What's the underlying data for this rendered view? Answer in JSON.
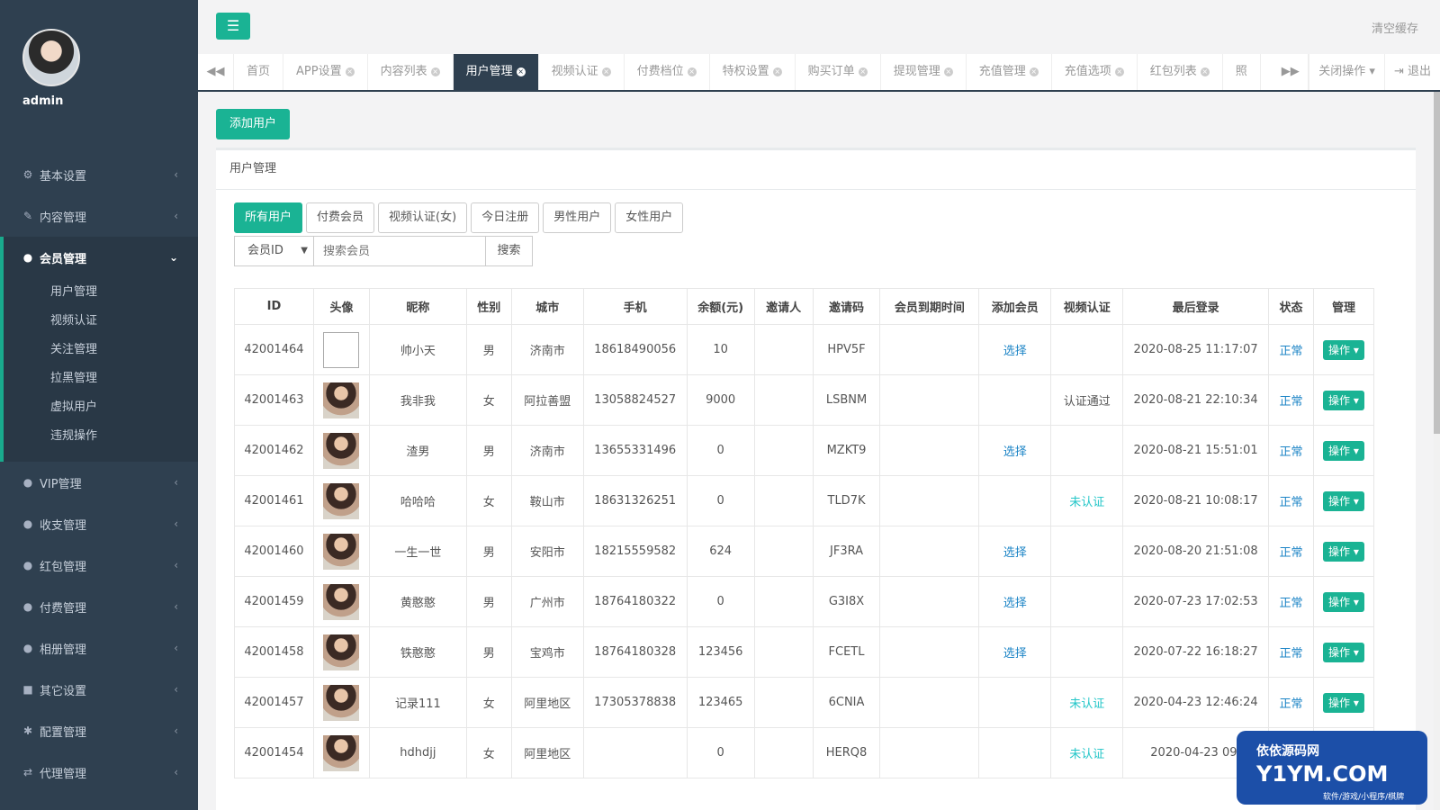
{
  "sidebar": {
    "admin_name": "admin",
    "nav": [
      {
        "label": "基本设置",
        "icon": "gear-icon"
      },
      {
        "label": "内容管理",
        "icon": "edit-icon"
      }
    ],
    "active_section": {
      "label": "会员管理",
      "sub_items": [
        "用户管理",
        "视频认证",
        "关注管理",
        "拉黑管理",
        "虚拟用户",
        "违规操作"
      ]
    },
    "nav_after": [
      {
        "label": "VIP管理",
        "icon": "user-icon"
      },
      {
        "label": "收支管理",
        "icon": "user-icon"
      },
      {
        "label": "红包管理",
        "icon": "user-icon"
      },
      {
        "label": "付费管理",
        "icon": "user-icon"
      },
      {
        "label": "相册管理",
        "icon": "user-icon"
      },
      {
        "label": "其它设置",
        "icon": "book-icon"
      },
      {
        "label": "配置管理",
        "icon": "asterisk-icon"
      },
      {
        "label": "代理管理",
        "icon": "exchange-icon"
      }
    ]
  },
  "topbar": {
    "clear_cache": "清空缓存"
  },
  "tabs": [
    "首页",
    "APP设置",
    "内容列表",
    "用户管理",
    "视频认证",
    "付费档位",
    "特权设置",
    "购买订单",
    "提现管理",
    "充值管理",
    "充值选项",
    "红包列表",
    "照"
  ],
  "tab_actions": {
    "close_ops": "关闭操作",
    "logout": "退出"
  },
  "main": {
    "add_user": "添加用户",
    "panel_title": "用户管理",
    "filters": [
      "所有用户",
      "付费会员",
      "视频认证(女)",
      "今日注册",
      "男性用户",
      "女性用户"
    ],
    "search": {
      "select_value": "会员ID",
      "placeholder": "搜索会员",
      "button": "搜索"
    }
  },
  "table": {
    "headers": [
      "ID",
      "头像",
      "昵称",
      "性别",
      "城市",
      "手机",
      "余额(元)",
      "邀请人",
      "邀请码",
      "会员到期时间",
      "添加会员",
      "视频认证",
      "最后登录",
      "状态",
      "管理"
    ],
    "rows": [
      {
        "id": "42001464",
        "avatar": "empty",
        "nick": "帅小天",
        "gender": "男",
        "city": "济南市",
        "phone": "18618490056",
        "balance": "10",
        "inviter": "",
        "code": "HPV5F",
        "expire": "",
        "add_member": "选择",
        "video": "",
        "last_login": "2020-08-25 11:17:07",
        "status": "正常",
        "op": "操作"
      },
      {
        "id": "42001463",
        "avatar": "photo",
        "nick": "我非我",
        "gender": "女",
        "city": "阿拉善盟",
        "phone": "13058824527",
        "balance": "9000",
        "inviter": "",
        "code": "LSBNM",
        "expire": "",
        "add_member": "",
        "video": "认证通过",
        "last_login": "2020-08-21 22:10:34",
        "status": "正常",
        "op": "操作"
      },
      {
        "id": "42001462",
        "avatar": "photo",
        "nick": "渣男",
        "gender": "男",
        "city": "济南市",
        "phone": "13655331496",
        "balance": "0",
        "inviter": "",
        "code": "MZKT9",
        "expire": "",
        "add_member": "选择",
        "video": "",
        "last_login": "2020-08-21 15:51:01",
        "status": "正常",
        "op": "操作"
      },
      {
        "id": "42001461",
        "avatar": "photo",
        "nick": "哈哈哈",
        "gender": "女",
        "city": "鞍山市",
        "phone": "18631326251",
        "balance": "0",
        "inviter": "",
        "code": "TLD7K",
        "expire": "",
        "add_member": "",
        "video": "未认证",
        "last_login": "2020-08-21 10:08:17",
        "status": "正常",
        "op": "操作"
      },
      {
        "id": "42001460",
        "avatar": "photo",
        "nick": "一生一世",
        "gender": "男",
        "city": "安阳市",
        "phone": "18215559582",
        "balance": "624",
        "inviter": "",
        "code": "JF3RA",
        "expire": "",
        "add_member": "选择",
        "video": "",
        "last_login": "2020-08-20 21:51:08",
        "status": "正常",
        "op": "操作"
      },
      {
        "id": "42001459",
        "avatar": "photo",
        "nick": "黄憨憨",
        "gender": "男",
        "city": "广州市",
        "phone": "18764180322",
        "balance": "0",
        "inviter": "",
        "code": "G3I8X",
        "expire": "",
        "add_member": "选择",
        "video": "",
        "last_login": "2020-07-23 17:02:53",
        "status": "正常",
        "op": "操作"
      },
      {
        "id": "42001458",
        "avatar": "photo",
        "nick": "铁憨憨",
        "gender": "男",
        "city": "宝鸡市",
        "phone": "18764180328",
        "balance": "123456",
        "inviter": "",
        "code": "FCETL",
        "expire": "",
        "add_member": "选择",
        "video": "",
        "last_login": "2020-07-22 16:18:27",
        "status": "正常",
        "op": "操作"
      },
      {
        "id": "42001457",
        "avatar": "photo",
        "nick": "记录111",
        "gender": "女",
        "city": "阿里地区",
        "phone": "17305378838",
        "balance": "123465",
        "inviter": "",
        "code": "6CNIA",
        "expire": "",
        "add_member": "",
        "video": "未认证",
        "last_login": "2020-04-23 12:46:24",
        "status": "正常",
        "op": "操作"
      },
      {
        "id": "42001454",
        "avatar": "photo",
        "nick": "hdhdjj",
        "gender": "女",
        "city": "阿里地区",
        "phone": "",
        "balance": "0",
        "inviter": "",
        "code": "HERQ8",
        "expire": "",
        "add_member": "",
        "video": "未认证",
        "last_login": "2020-04-23 09:",
        "status": "",
        "op": ""
      }
    ]
  },
  "watermark": {
    "line1": "依依源码网",
    "line2": "Y1YM.COM",
    "line3": "软件/游戏/小程序/棋牌"
  },
  "colors": {
    "sidebar_bg": "#2f4050",
    "accent": "#1ab394",
    "link": "#1c84c6"
  }
}
